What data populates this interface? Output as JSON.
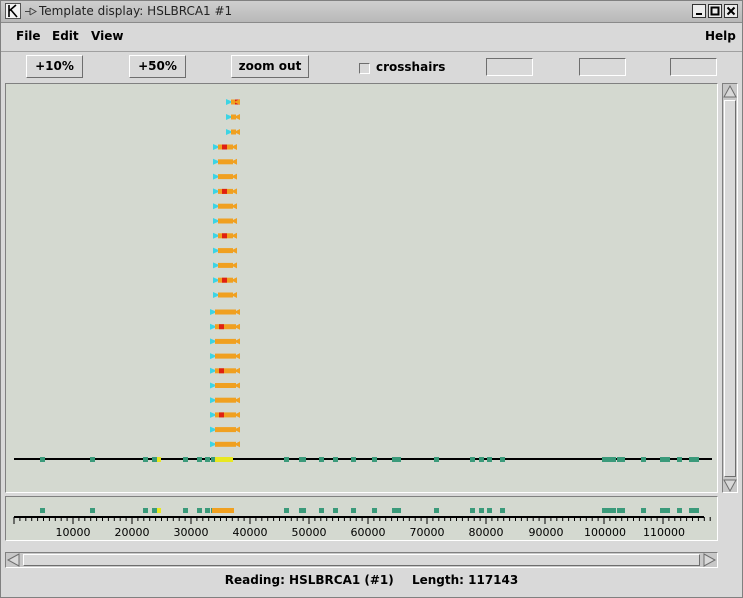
{
  "window": {
    "title": "Template display: HSLBRCA1 #1"
  },
  "menu": {
    "file": "File",
    "edit": "Edit",
    "view": "View",
    "help": "Help"
  },
  "toolbar": {
    "zoom10": "+10%",
    "zoom50": "+50%",
    "zoomout": "zoom out",
    "crosshairs": "crosshairs"
  },
  "status": {
    "reading_label": "Reading: HSLBRCA1 (#1)",
    "length_label": "Length: 117143"
  },
  "axis": {
    "ticks": [
      "10000",
      "20000",
      "30000",
      "40000",
      "50000",
      "60000",
      "70000",
      "80000",
      "90000",
      "100000",
      "110000"
    ]
  },
  "colors": {
    "background": "#d4d9d0",
    "cyan": "#3cd4e4",
    "orange": "#f0a020",
    "red": "#e02010",
    "teal": "#3a9a7a",
    "yellow": "#e8e820"
  }
}
